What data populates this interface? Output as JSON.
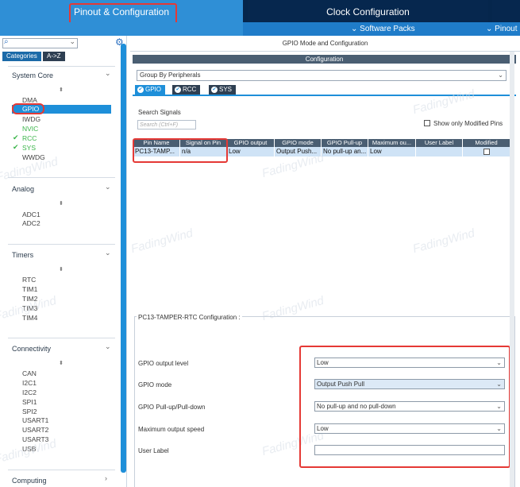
{
  "top_tabs": {
    "pinout": "Pinout & Configuration",
    "clock": "Clock Configuration"
  },
  "sub_bar": {
    "software_packs": "Software Packs",
    "pinout": "Pinout"
  },
  "left_panel": {
    "search_placeholder": "",
    "categories_label": "Categories",
    "az_label": "A->Z",
    "sections": {
      "system_core": {
        "title": "System Core",
        "items": [
          "DMA",
          "GPIO",
          "IWDG",
          "NVIC",
          "RCC",
          "SYS",
          "WWDG"
        ]
      },
      "analog": {
        "title": "Analog",
        "items": [
          "ADC1",
          "ADC2"
        ]
      },
      "timers": {
        "title": "Timers",
        "items": [
          "RTC",
          "TIM1",
          "TIM2",
          "TIM3",
          "TIM4"
        ]
      },
      "connectivity": {
        "title": "Connectivity",
        "items": [
          "CAN",
          "I2C1",
          "I2C2",
          "SPI1",
          "SPI2",
          "USART1",
          "USART2",
          "USART3",
          "USB"
        ]
      },
      "computing": {
        "title": "Computing"
      }
    }
  },
  "right_panel": {
    "title": "GPIO Mode and Configuration",
    "config_bar": "Configuration",
    "group_select": "Group By Peripherals",
    "tabs": [
      "GPIO",
      "RCC",
      "SYS"
    ],
    "search_label": "Search Signals",
    "search_placeholder": "Search (Ctrl+F)",
    "show_modified": "Show only Modified Pins",
    "table": {
      "headers": [
        "Pin Name",
        "Signal on Pin",
        "GPIO output",
        "GPIO mode",
        "GPIO Pull-up",
        "Maximum ou...",
        "User Label",
        "Modified"
      ],
      "row": [
        "PC13-TAMP...",
        "n/a",
        "Low",
        "Output Push...",
        "No pull-up an...",
        "Low",
        "",
        ""
      ]
    },
    "pin_config": {
      "legend": "PC13-TAMPER-RTC Configuration :",
      "fields": [
        {
          "label": "GPIO output level",
          "value": "Low"
        },
        {
          "label": "GPIO mode",
          "value": "Output Push Pull"
        },
        {
          "label": "GPIO Pull-up/Pull-down",
          "value": "No pull-up and no pull-down"
        },
        {
          "label": "Maximum output speed",
          "value": "Low"
        },
        {
          "label": "User Label",
          "value": ""
        }
      ]
    }
  },
  "watermark": "FadingWind",
  "colors": {
    "accent": "#1e8fd9",
    "dark_header": "#05264c",
    "green": "#3bb54a",
    "highlight_box": "#e53935"
  }
}
